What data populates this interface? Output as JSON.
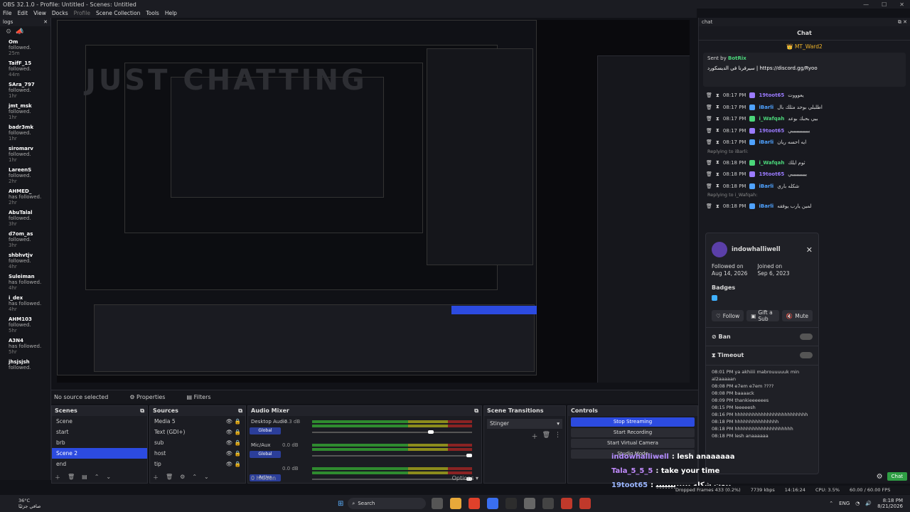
{
  "window": {
    "title": "OBS 32.1.0 - Profile: Untitled - Scenes: Untitled"
  },
  "menu": [
    "File",
    "Edit",
    "View",
    "Docks",
    "Profile",
    "Scene Collection",
    "Tools",
    "Help"
  ],
  "logs": {
    "title": "logs",
    "items": [
      {
        "user": "Om",
        "text": "followed.",
        "time": "25m"
      },
      {
        "user": "TaifF_15",
        "text": "followed.",
        "time": "44m"
      },
      {
        "user": "SAra_797",
        "text": "followed.",
        "time": "1hr"
      },
      {
        "user": "jmt_msk",
        "text": "followed.",
        "time": "1hr"
      },
      {
        "user": "badr3mk",
        "text": "followed.",
        "time": "1hr"
      },
      {
        "user": "siromarv",
        "text": "followed.",
        "time": "1hr"
      },
      {
        "user": "LareenS",
        "text": "followed.",
        "time": "2hr"
      },
      {
        "user": "AHMED_",
        "text": "has followed.",
        "time": "2hr"
      },
      {
        "user": "AbuTalal",
        "text": "followed.",
        "time": "3hr"
      },
      {
        "user": "d7om_as",
        "text": "followed.",
        "time": "3hr"
      },
      {
        "user": "shbhvtjv",
        "text": "followed.",
        "time": "4hr"
      },
      {
        "user": "Suleiman",
        "text": "has followed.",
        "time": "4hr"
      },
      {
        "user": "i_dex",
        "text": "has followed.",
        "time": "4hr"
      },
      {
        "user": "AHM103",
        "text": "followed.",
        "time": "5hr"
      },
      {
        "user": "A3N4",
        "text": "has followed.",
        "time": "5hr"
      },
      {
        "user": "jhsjsjsh",
        "text": "followed.",
        "time": ""
      }
    ]
  },
  "preview": {
    "watermark": "JUST CHATTING"
  },
  "status_row": {
    "no_source": "No source selected",
    "properties": "Properties",
    "filters": "Filters"
  },
  "scenes": {
    "title": "Scenes",
    "items": [
      "Scene",
      "start",
      "brb",
      "Scene 2",
      "end"
    ],
    "selected": 3
  },
  "sources": {
    "title": "Sources",
    "items": [
      "Media 5",
      "Text (GDI+)",
      "sub",
      "host",
      "tip"
    ]
  },
  "mixer": {
    "title": "Audio Mixer",
    "channels": [
      {
        "name": "Desktop Audio",
        "db": "-7.3 dB",
        "level": 0.75,
        "tag": "Global"
      },
      {
        "name": "Mic/Aux",
        "db": "0.0 dB",
        "level": 1.0,
        "tag": "Global"
      },
      {
        "name": "",
        "db": "0.0 dB",
        "level": 1.0,
        "tag": "Active"
      }
    ],
    "hidden": "0 hidden"
  },
  "transitions": {
    "title": "Scene Transitions",
    "value": "Stinger"
  },
  "controls": {
    "title": "Controls",
    "buttons": [
      "Stop Streaming",
      "Start Recording",
      "Start Virtual Camera",
      "Studio Mode"
    ]
  },
  "chat": {
    "dock_title": "chat",
    "title": "Chat",
    "pinned_by_header": "MT_Ward2",
    "pinned_sender": "Sent by",
    "pinned_bot": "BotRix",
    "pinned_text": "سيرفرنا في الديسكورد | https://discord.gg/Ryoo",
    "messages": [
      {
        "time": "08:17 PM",
        "user": "19toot65",
        "color": "#9b7bff",
        "text": "يعوووت"
      },
      {
        "time": "08:17 PM",
        "user": "iBarli",
        "color": "#4fa2ff",
        "text": "اطلبلي بوحد مثلك بال"
      },
      {
        "time": "08:17 PM",
        "user": "i_Wafqah",
        "color": "#4bd67a",
        "text": "بيي بحبك بوعد"
      },
      {
        "time": "08:17 PM",
        "user": "19toot65",
        "color": "#9b7bff",
        "text": "ييييييييييييي"
      },
      {
        "time": "08:17 PM",
        "user": "iBarli",
        "color": "#4fa2ff",
        "text": "ايه احسه ريان"
      },
      {
        "time": "08:18 PM",
        "user": "i_Wafqah",
        "color": "#4bd67a",
        "text": "ثوم ايلك"
      },
      {
        "time": "08:18 PM",
        "user": "19toot65",
        "color": "#9b7bff",
        "text": "ييييييييييي"
      },
      {
        "time": "08:18 PM",
        "user": "iBarli",
        "color": "#4fa2ff",
        "text": "شكله باري"
      },
      {
        "time": "08:18 PM",
        "user": "iBarli",
        "color": "#4fa2ff",
        "text": "لمين يارب يوفقه"
      }
    ],
    "reply_1": "Replying to iBarli:",
    "reply_2": "Replying to i_Wafqah:",
    "chat_button": "Chat"
  },
  "usercard": {
    "name": "indowhalliwell",
    "followed_label": "Followed on",
    "followed_value": "Aug 14, 2026",
    "joined_label": "Joined on",
    "joined_value": "Sep 6, 2023",
    "badges": "Badges",
    "follow": "Follow",
    "gift": "Gift a Sub",
    "mute": "Mute",
    "ban": "Ban",
    "timeout": "Timeout",
    "history": [
      "08:08 PM e7em e7em ????",
      "08:08 PM baaaack",
      "08:09 PM thankieeeeees",
      "08:15 PM leeeeesh",
      "08:16 PM hhhhhhhhhhhhhhhhhhhhhhhhh",
      "08:18 PM hhhhhhhhhhhhhhh",
      "08:18 PM hhhhhhhhhhhhhhhhhhhh",
      "08:18 PM lesh anaaaaaa"
    ],
    "history_top": "08:01 PM ya akhiiii mabrouuuuuk min al2aaaaan"
  },
  "overlay": [
    {
      "user": "indowhalliwell",
      "text": ": lesh anaaaaaa",
      "color": "#b48cff"
    },
    {
      "user": "Tala_5_5_5",
      "text": ": take your time",
      "color": "#c38cff"
    },
    {
      "user": "19toot65",
      "text": ": بيوت شكله ﻳﻴﻴﻴﻴﻴﻴﻴﻴﻴﻴﻴ",
      "color": "#9bb6ff"
    }
  ],
  "obs_status": {
    "dropped": "Dropped Frames 433 (0.2%)",
    "kbps": "7739 kbps",
    "time": "14:16:24",
    "cpu": "CPU: 3.5%",
    "fps": "60.00 / 60.00 FPS"
  },
  "taskbar": {
    "weather_temp": "36°C",
    "weather_text": "صافي جزئيًا",
    "search": "Search",
    "lang": "ENG",
    "clock": "8:18 PM",
    "date": "8/21/2026"
  }
}
